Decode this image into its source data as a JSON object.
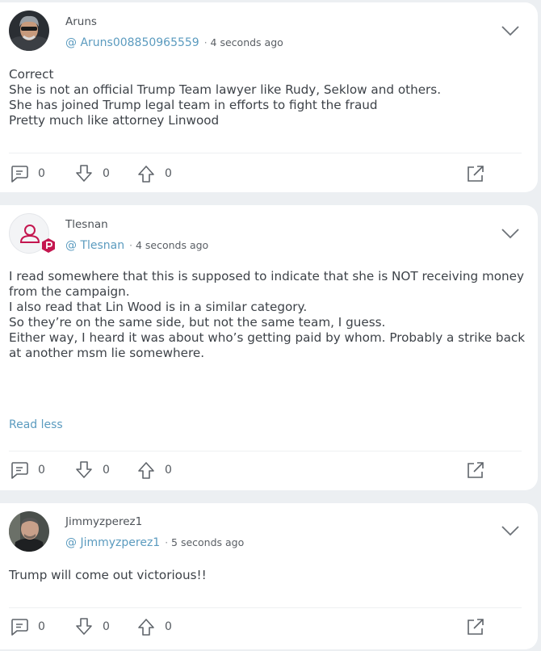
{
  "posts": [
    {
      "username": "Aruns",
      "handle": "@ Aruns008850965559",
      "separator": "·",
      "time": "4 seconds ago",
      "lines": [
        "Correct",
        "She is not an official Trump Team lawyer like Rudy, Seklow and others.",
        "She has joined Trump legal team in efforts to fight the fraud",
        "Pretty much like attorney Linwood"
      ],
      "comments": "0",
      "downvotes": "0",
      "upvotes": "0"
    },
    {
      "username": "Tlesnan",
      "handle": "@ Tlesnan",
      "separator": "·",
      "time": "4 seconds ago",
      "paragraphs": [
        "I read somewhere that this is supposed to indicate that she is NOT receiving money from the campaign.",
        "I also read that Lin Wood is in a similar category.",
        "So they’re on the same side, but not the same team, I guess.",
        "Either way, I heard it was about who’s getting paid by whom. Probably a strike back at another msm lie somewhere."
      ],
      "read_less": "Read less",
      "comments": "0",
      "downvotes": "0",
      "upvotes": "0"
    },
    {
      "username": "Jimmyzperez1",
      "handle": "@ Jimmyzperez1",
      "separator": "·",
      "time": "5 seconds ago",
      "lines": [
        "Trump will come out victorious!!"
      ],
      "comments": "0",
      "downvotes": "0",
      "upvotes": "0"
    }
  ],
  "colors": {
    "background": "#eceff2",
    "card": "#ffffff",
    "handle": "#5b9bbf",
    "brand_badge": "#c4164f",
    "text": "#3d4248"
  },
  "icons": [
    "chevron-down-icon",
    "comment-icon",
    "downvote-arrow-icon",
    "upvote-arrow-icon",
    "share-icon",
    "default-user-icon",
    "brand-badge-icon"
  ]
}
